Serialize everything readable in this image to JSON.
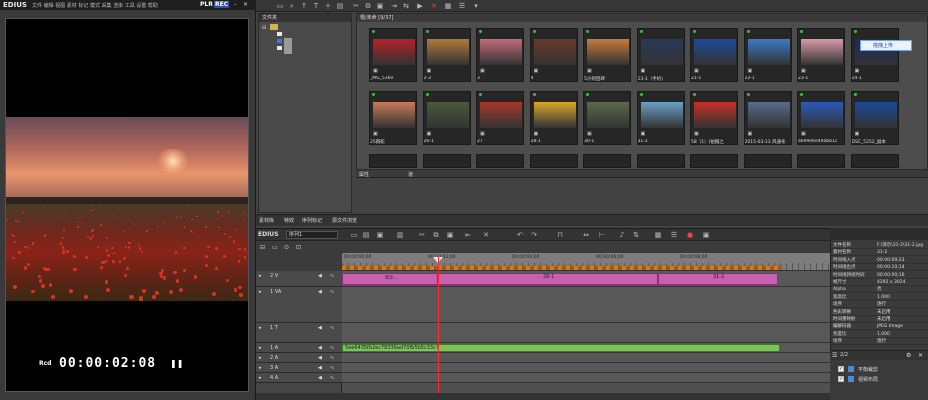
{
  "player": {
    "logo": "EDIUS",
    "menu": "文件 编辑 视图 素材 标记 模式 采集 渲染 工具 设置 帮助",
    "plr": "PLR",
    "rec": "REC",
    "rcd_label": "Rcd",
    "timecode": "00:00:02:08"
  },
  "bin": {
    "folder_header": "文件夹",
    "clip_header": "根/未命 [9/37]",
    "upload_tip": "拖拽上传",
    "props_left": "属性",
    "props_right": "道",
    "tabs": [
      "素材库",
      "特效",
      "序列标记",
      "源文件浏览"
    ],
    "thumbs_row1": [
      {
        "label": "_MG_5360",
        "color": "#b8202a"
      },
      {
        "label": "2-3",
        "color": "#b07a3a"
      },
      {
        "label": "3",
        "color": "#c46a7a"
      },
      {
        "label": "4",
        "color": "#6a3a2a"
      },
      {
        "label": "5沙则团碑",
        "color": "#c87a3a"
      },
      {
        "label": "13-1（手机）",
        "color": "#2a3a5a"
      },
      {
        "label": "21-1",
        "color": "#1e4a9a"
      },
      {
        "label": "22-1",
        "color": "#3a7ac8"
      },
      {
        "label": "23-1",
        "color": "#d89aaa"
      },
      {
        "label": "24-1",
        "color": "#1a2a6a"
      }
    ],
    "thumbs_row2": [
      {
        "label": "25跳蛇",
        "color": "#c87a5a"
      },
      {
        "label": "26-1",
        "color": "#4a5a3a"
      },
      {
        "label": "27",
        "color": "#a8382a"
      },
      {
        "label": "28-1",
        "color": "#d8a82a"
      },
      {
        "label": "30-1",
        "color": "#5a6a4a"
      },
      {
        "label": "31-2",
        "color": "#6aa0c8"
      },
      {
        "label": "58（1）(拍摄之",
        "color": "#c8302a"
      },
      {
        "label": "2015-03-13 风通冬",
        "color": "#5a6a8a"
      },
      {
        "label": "a699e6e49ab61c",
        "color": "#2a5ab8"
      },
      {
        "label": "DSC_5252_副本",
        "color": "#1a4a9a"
      }
    ]
  },
  "timeline": {
    "logo": "EDIUS",
    "sequence": "序列1",
    "ruler_labels": [
      "00:00:00;00",
      "00:00:02;00",
      "00:00:04;00",
      "00:00:06;00",
      "00:00:08;00"
    ],
    "tracks": [
      {
        "name": "2 V",
        "clips": [
          "9沙...",
          "28-1",
          "31-2"
        ]
      },
      {
        "name": "1 VA",
        "clips": []
      },
      {
        "name": "1 T",
        "clips": []
      },
      {
        "name": "1 A",
        "clips": [
          "5ee6435fb2ec78336ad70fb5b5c33c7"
        ]
      },
      {
        "name": "2 A",
        "clips": []
      },
      {
        "name": "3 A",
        "clips": []
      },
      {
        "name": "4 A",
        "clips": []
      }
    ]
  },
  "info": {
    "rows": [
      {
        "k": "文件名称",
        "v": "F:\\演示\\31-2\\31-2.jpg"
      },
      {
        "k": "素材名称",
        "v": "31-2"
      },
      {
        "k": "时间线入点",
        "v": "00:00:09;23"
      },
      {
        "k": "时间线出点",
        "v": "00:00:10;14"
      },
      {
        "k": "时间线持续时间",
        "v": "00:00:00;16"
      },
      {
        "k": "帧尺寸",
        "v": "4292 x 3024"
      },
      {
        "k": "Alpha",
        "v": "否"
      },
      {
        "k": "宽高比",
        "v": "1.000"
      },
      {
        "k": "场序",
        "v": "逐行"
      },
      {
        "k": "色彩转换",
        "v": "未启用"
      },
      {
        "k": "时间重映射",
        "v": "未启用"
      },
      {
        "k": "编解码器",
        "v": "JPEG Image"
      },
      {
        "k": "亮度比",
        "v": "1.000"
      },
      {
        "k": "场序",
        "v": "逐行"
      }
    ],
    "markers_head": "2/2",
    "markers": [
      "平衡裁剪",
      "视频布局"
    ]
  }
}
